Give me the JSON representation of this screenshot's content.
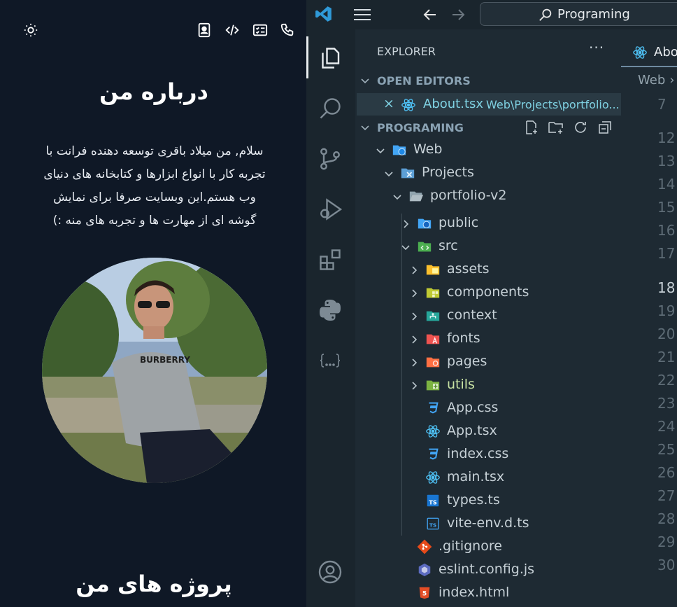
{
  "portfolio": {
    "about_title": "درباره من",
    "about_text": "سلام, من میلاد باقری توسعه دهنده فرانت با تجربه کار با انواع ابزارها و کتابخانه های دنیای وب هستم.این وبسایت صرفا برای نمایش گوشه ای از مهارت ها و تجربه های منه :)",
    "projects_title": "پروژه های من",
    "photo_text": "BURBERRY",
    "icons": [
      "sun-icon",
      "contact-card-icon",
      "code-icon",
      "resume-icon",
      "phone-icon"
    ]
  },
  "vscode": {
    "search_label": "Programing",
    "explorer_title": "EXPLORER",
    "explorer_more": "···",
    "open_editors_title": "OPEN EDITORS",
    "open_editor": {
      "close": "×",
      "name": "About.tsx",
      "path": "Web\\Projects\\portfolio..."
    },
    "programing_title": "PROGRAMING",
    "tree": [
      {
        "label": "Web",
        "icon": "web-folder"
      },
      {
        "label": "Projects",
        "icon": "projects-folder"
      },
      {
        "label": "portfolio-v2",
        "icon": "folder"
      },
      {
        "label": "public",
        "icon": "public-folder"
      },
      {
        "label": "src",
        "icon": "src-folder"
      },
      {
        "label": "assets",
        "icon": "assets-folder"
      },
      {
        "label": "components",
        "icon": "components-folder"
      },
      {
        "label": "context",
        "icon": "context-folder"
      },
      {
        "label": "fonts",
        "icon": "fonts-folder"
      },
      {
        "label": "pages",
        "icon": "pages-folder"
      },
      {
        "label": "utils",
        "icon": "utils-folder"
      },
      {
        "label": "App.css",
        "icon": "css-file"
      },
      {
        "label": "App.tsx",
        "icon": "react-file"
      },
      {
        "label": "index.css",
        "icon": "css-file"
      },
      {
        "label": "main.tsx",
        "icon": "react-file"
      },
      {
        "label": "types.ts",
        "icon": "ts-file"
      },
      {
        "label": "vite-env.d.ts",
        "icon": "ts-def-file"
      },
      {
        "label": ".gitignore",
        "icon": "git-file"
      },
      {
        "label": "eslint.config.js",
        "icon": "eslint-file"
      },
      {
        "label": "index.html",
        "icon": "html-file"
      }
    ],
    "tab_label": "About.tsx",
    "breadcrumb": "Web",
    "breadcrumb_sep": "›",
    "line_numbers": [
      "7",
      "12",
      "13",
      "14",
      "15",
      "16",
      "17",
      "18",
      "19",
      "20",
      "21",
      "22",
      "23",
      "24",
      "25",
      "26",
      "27",
      "28",
      "29",
      "30"
    ],
    "current_line": "18",
    "colors": {
      "accent": "#7fd1e2",
      "react": "#4fc3f7",
      "bg": "#1e2a33",
      "portfolio_bg": "#0f1826"
    }
  }
}
